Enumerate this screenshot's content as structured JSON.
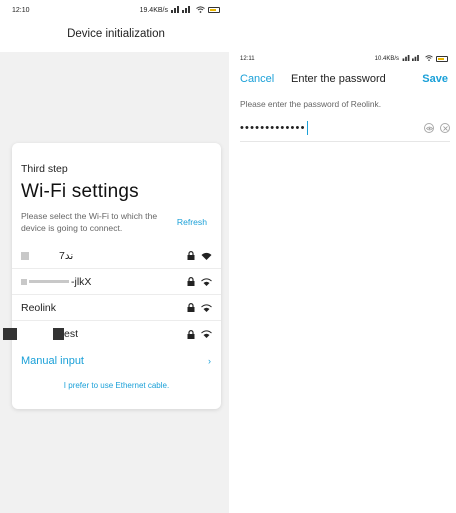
{
  "left_screen": {
    "status_time": "12:10",
    "status_net": "19.4KB/s",
    "nav_title": "Device initialization",
    "card": {
      "step_label": "Third step",
      "title": "Wi-Fi settings",
      "hint": "Please select the Wi-Fi to which the device is going to connect.",
      "refresh_label": "Refresh",
      "networks": [
        {
          "name": "ند7",
          "locked": true
        },
        {
          "name": "-jlkX",
          "locked": true
        },
        {
          "name": "Reolink",
          "locked": true
        },
        {
          "name": "est",
          "locked": true
        }
      ],
      "manual_label": "Manual input",
      "manual_chevron": "›",
      "ethernet_label": "I prefer to use Ethernet cable."
    }
  },
  "right_screen": {
    "status_time": "12:11",
    "status_net": "10.4KB/s",
    "cancel_label": "Cancel",
    "title": "Enter the password",
    "save_label": "Save",
    "hint": "Please enter the password of Reolink.",
    "password_mask": "•••••••••••••"
  },
  "colors": {
    "accent": "#1aa0d8",
    "left_bg": "#f1f1f1"
  },
  "icons": [
    "lock-icon",
    "wifi-icon",
    "eye-icon",
    "clear-icon",
    "battery-icon",
    "signal-icon",
    "chevron-right-icon"
  ]
}
